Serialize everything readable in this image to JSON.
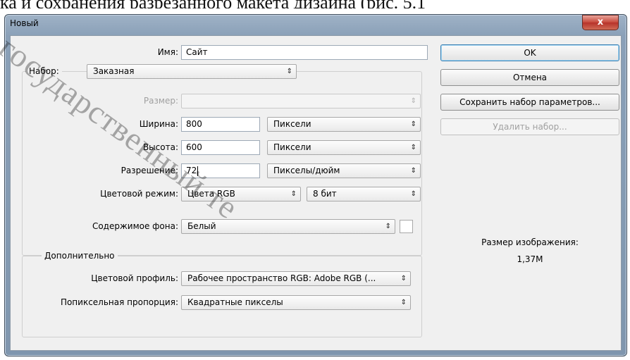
{
  "background_text": "ка и сохранения разрезанного макета дизайна (рис. 5.1",
  "window": {
    "title": "Новый",
    "close_glyph": "x"
  },
  "form": {
    "name_label": "Имя:",
    "name_value": "Сайт",
    "preset_label": "Набор:",
    "preset_value": "Заказная",
    "size_label": "Размер:",
    "size_value": "",
    "width_label": "Ширина:",
    "width_value": "800",
    "width_unit": "Пиксели",
    "height_label": "Высота:",
    "height_value": "600",
    "height_unit": "Пиксели",
    "resolution_label": "Разрешение:",
    "resolution_value": "72",
    "resolution_unit": "Пикселы/дюйм",
    "color_mode_label": "Цветовой режим:",
    "color_mode_value": "Цвета RGB",
    "bit_depth_value": "8 бит",
    "background_label": "Содержимое фона:",
    "background_value": "Белый",
    "background_swatch_color": "#ffffff"
  },
  "advanced": {
    "legend": "Дополнительно",
    "color_profile_label": "Цветовой профиль:",
    "color_profile_value": "Рабочее пространство RGB:  Adobe RGB (...",
    "pixel_aspect_label": "Попиксельная пропорция:",
    "pixel_aspect_value": "Квадратные пикселы"
  },
  "buttons": {
    "ok": "OK",
    "cancel": "Отмена",
    "save_preset": "Сохранить набор параметров...",
    "delete_preset": "Удалить набор..."
  },
  "info": {
    "image_size_label": "Размер изображения:",
    "image_size_value": "1,37M"
  },
  "watermark": "государственный те"
}
